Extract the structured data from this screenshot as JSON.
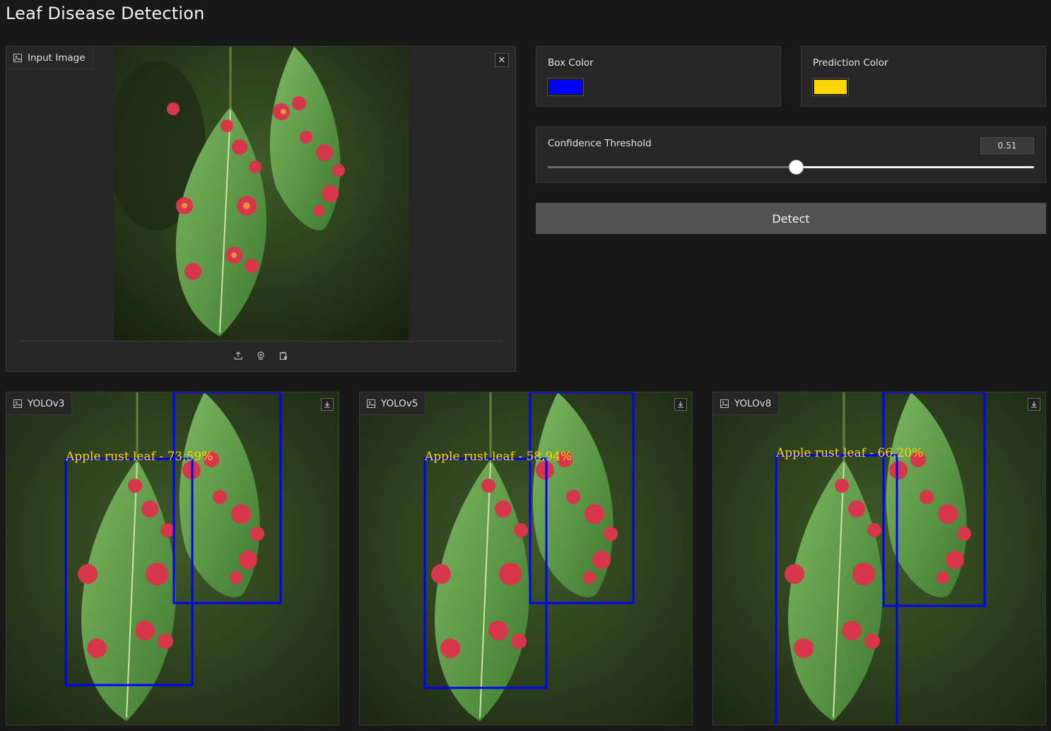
{
  "app": {
    "title": "Leaf Disease Detection"
  },
  "input": {
    "label": "Input Image",
    "icons": [
      "image-icon",
      "close-icon",
      "upload-icon",
      "webcam-icon",
      "clipboard-icon"
    ]
  },
  "box_color": {
    "label": "Box Color",
    "value": "#0000ff"
  },
  "prediction_color": {
    "label": "Prediction Color",
    "value": "#ffd700"
  },
  "threshold": {
    "label": "Confidence Threshold",
    "value": "0.51",
    "fraction": 0.51
  },
  "detect": {
    "label": "Detect"
  },
  "outputs": [
    {
      "label": "YOLOv3",
      "prediction": "Apple rust leaf - 73.59%"
    },
    {
      "label": "YOLOv5",
      "prediction": "Apple rust leaf - 58.94%"
    },
    {
      "label": "YOLOv8",
      "prediction": "Apple rust leaf - 66.20%"
    }
  ],
  "colors": {
    "background": "#181818",
    "panel": "#262626",
    "box": "#0000ff",
    "prediction": "#ffd700",
    "button": "#525252"
  }
}
